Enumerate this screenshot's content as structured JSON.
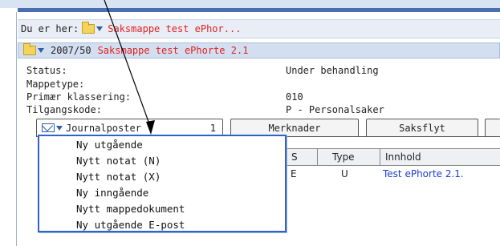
{
  "breadcrumb": {
    "prefix": "Du er her:",
    "path": "Saksmappe test ePhor..."
  },
  "case": {
    "number": "2007/50",
    "title": "Saksmappe test ePhorte 2.1"
  },
  "metadata": [
    {
      "label": "Status:",
      "value": "Under behandling"
    },
    {
      "label": "Mappetype:",
      "value": ""
    },
    {
      "label": "Primær klassering:",
      "value": "010"
    },
    {
      "label": "Tilgangskode:",
      "value": "P - Personalsaker"
    }
  ],
  "tabs": [
    {
      "label": "Journalposter",
      "count": "1"
    },
    {
      "label": "Merknader"
    },
    {
      "label": "Saksflyt"
    }
  ],
  "grid": {
    "columns": [
      "S",
      "Type",
      "Innhold"
    ],
    "rows": [
      {
        "s": "E",
        "type": "U",
        "innhold": "Test ePhorte 2.1."
      }
    ]
  },
  "menu": {
    "items": [
      "Ny utgående",
      "Nytt notat (N)",
      "Nytt notat (X)",
      "Ny inngående",
      "Nytt mappedokument",
      "Ny utgående E-post"
    ]
  },
  "colors": {
    "accent_red": "#e02020",
    "menu_border": "#2f63c7",
    "link_blue": "#1a3fd1"
  },
  "icons": [
    "folder-icon",
    "dropdown-caret-icon",
    "mail-icon",
    "arrow-annotation"
  ]
}
